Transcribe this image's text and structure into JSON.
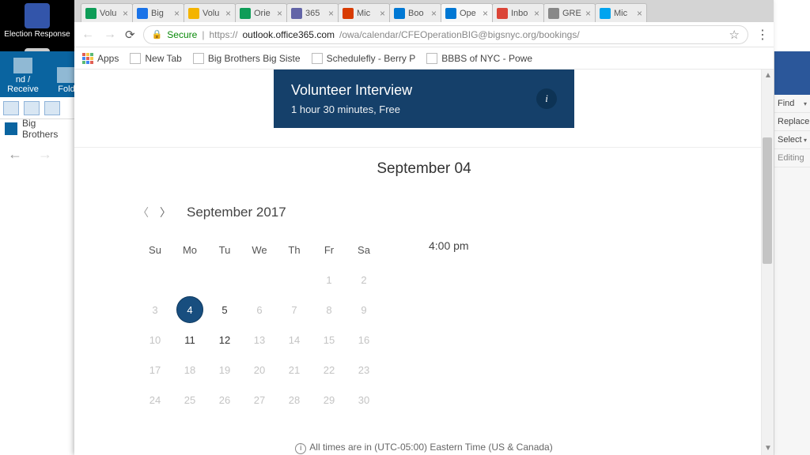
{
  "desktop": {
    "icon1": "Election Response"
  },
  "outlook": {
    "send_receive": "nd / Receive",
    "folder": "Fold",
    "tab": "Big Brothers"
  },
  "word_pane": {
    "find": "Find",
    "replace": "Replace",
    "select": "Select",
    "editing": "Editing"
  },
  "tabs": [
    {
      "label": "Volu",
      "color": "#0f9d58"
    },
    {
      "label": "Big",
      "color": "#1a73e8"
    },
    {
      "label": "Volu",
      "color": "#f4b400"
    },
    {
      "label": "Orie",
      "color": "#0f9d58"
    },
    {
      "label": "365",
      "color": "#6264a7"
    },
    {
      "label": "Mic",
      "color": "#d83b01"
    },
    {
      "label": "Boo",
      "color": "#0078d4"
    },
    {
      "label": "Ope",
      "color": "#0078d4",
      "active": true
    },
    {
      "label": "Inbo",
      "color": "#db4437"
    },
    {
      "label": "GRE",
      "color": "#888888"
    },
    {
      "label": "Mic",
      "color": "#00a4ef"
    }
  ],
  "address": {
    "secure": "Secure",
    "scheme": "https://",
    "host": "outlook.office365.com",
    "path": "/owa/calendar/CFEOperationBIG@bigsnyc.org/bookings/"
  },
  "bookmarks": {
    "apps": "Apps",
    "items": [
      "New Tab",
      "Big Brothers Big Siste",
      "Schedulefly - Berry P",
      "BBBS of NYC - Powe"
    ]
  },
  "service": {
    "title": "Volunteer Interview",
    "subtitle": "1 hour 30 minutes, Free"
  },
  "date_heading": "September 04",
  "calendar": {
    "month_label": "September 2017",
    "dow": [
      "Su",
      "Mo",
      "Tu",
      "We",
      "Th",
      "Fr",
      "Sa"
    ],
    "weeks": [
      [
        {
          "n": ""
        },
        {
          "n": ""
        },
        {
          "n": ""
        },
        {
          "n": ""
        },
        {
          "n": ""
        },
        {
          "n": "1"
        },
        {
          "n": "2"
        }
      ],
      [
        {
          "n": "3"
        },
        {
          "n": "4",
          "avail": true,
          "selected": true
        },
        {
          "n": "5",
          "avail": true
        },
        {
          "n": "6"
        },
        {
          "n": "7"
        },
        {
          "n": "8"
        },
        {
          "n": "9"
        }
      ],
      [
        {
          "n": "10"
        },
        {
          "n": "11",
          "avail": true
        },
        {
          "n": "12",
          "avail": true
        },
        {
          "n": "13"
        },
        {
          "n": "14"
        },
        {
          "n": "15"
        },
        {
          "n": "16"
        }
      ],
      [
        {
          "n": "17"
        },
        {
          "n": "18"
        },
        {
          "n": "19"
        },
        {
          "n": "20"
        },
        {
          "n": "21"
        },
        {
          "n": "22"
        },
        {
          "n": "23"
        }
      ],
      [
        {
          "n": "24"
        },
        {
          "n": "25"
        },
        {
          "n": "26"
        },
        {
          "n": "27"
        },
        {
          "n": "28"
        },
        {
          "n": "29"
        },
        {
          "n": "30"
        }
      ]
    ]
  },
  "times": [
    "4:00 pm"
  ],
  "tz_note": "All times are in (UTC-05:00) Eastern Time (US & Canada)"
}
